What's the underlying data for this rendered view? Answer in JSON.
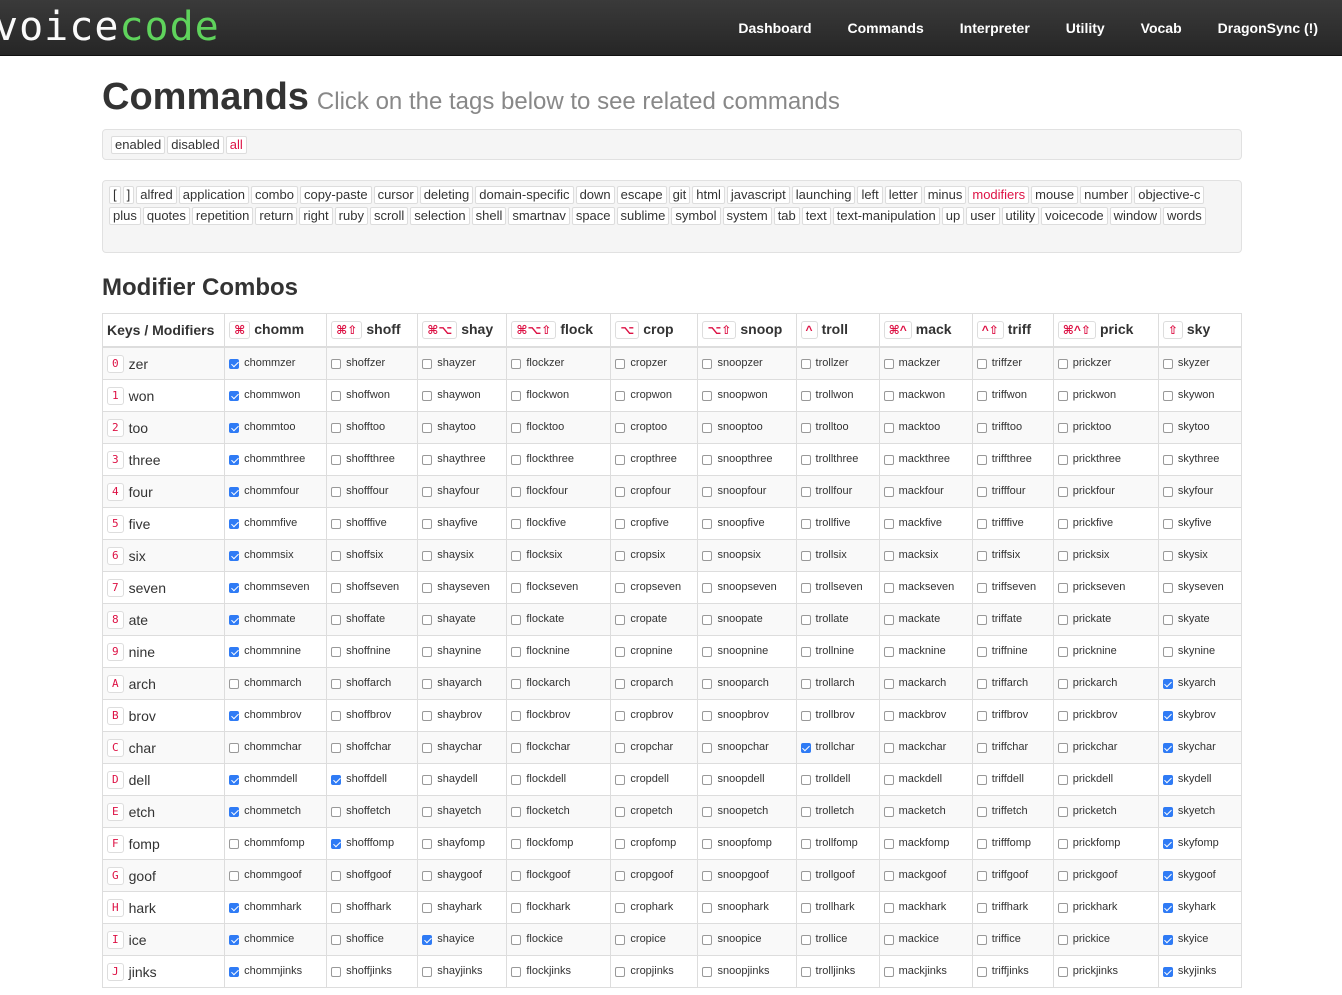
{
  "brand": {
    "part1": "voice",
    "part2": "code"
  },
  "nav": [
    "Dashboard",
    "Commands",
    "Interpreter",
    "Utility",
    "Vocab",
    "DragonSync (!)"
  ],
  "page": {
    "title": "Commands",
    "subtitle": "Click on the tags below to see related commands"
  },
  "status_filters": [
    {
      "label": "enabled",
      "active": false
    },
    {
      "label": "disabled",
      "active": false
    },
    {
      "label": "all",
      "active": true
    }
  ],
  "tags": [
    "[",
    "]",
    "alfred",
    "application",
    "combo",
    "copy-paste",
    "cursor",
    "deleting",
    "domain-specific",
    "down",
    "escape",
    "git",
    "html",
    "javascript",
    "launching",
    "left",
    "letter",
    "minus",
    "modifiers",
    "mouse",
    "number",
    "objective-c",
    "plus",
    "quotes",
    "repetition",
    "return",
    "right",
    "ruby",
    "scroll",
    "selection",
    "shell",
    "smartnav",
    "space",
    "sublime",
    "symbol",
    "system",
    "tab",
    "text",
    "text-manipulation",
    "up",
    "user",
    "utility",
    "voicecode",
    "window",
    "words"
  ],
  "active_tag": "modifiers",
  "section_title": "Modifier Combos",
  "table": {
    "first_header": "Keys / Modifiers",
    "modifiers": [
      {
        "symbol": "⌘",
        "name": "chomm"
      },
      {
        "symbol": "⌘⇧",
        "name": "shoff"
      },
      {
        "symbol": "⌘⌥",
        "name": "shay"
      },
      {
        "symbol": "⌘⌥⇧",
        "name": "flock"
      },
      {
        "symbol": "⌥",
        "name": "crop"
      },
      {
        "symbol": "⌥⇧",
        "name": "snoop"
      },
      {
        "symbol": "^",
        "name": "troll"
      },
      {
        "symbol": "⌘^",
        "name": "mack"
      },
      {
        "symbol": "^⇧",
        "name": "triff"
      },
      {
        "symbol": "⌘^⇧",
        "name": "prick"
      },
      {
        "symbol": "⇧",
        "name": "sky"
      }
    ],
    "rows": [
      {
        "key": "0",
        "spoken": "zer",
        "enabled": [
          1,
          0,
          0,
          0,
          0,
          0,
          0,
          0,
          0,
          0,
          0
        ]
      },
      {
        "key": "1",
        "spoken": "won",
        "enabled": [
          1,
          0,
          0,
          0,
          0,
          0,
          0,
          0,
          0,
          0,
          0
        ]
      },
      {
        "key": "2",
        "spoken": "too",
        "enabled": [
          1,
          0,
          0,
          0,
          0,
          0,
          0,
          0,
          0,
          0,
          0
        ]
      },
      {
        "key": "3",
        "spoken": "three",
        "enabled": [
          1,
          0,
          0,
          0,
          0,
          0,
          0,
          0,
          0,
          0,
          0
        ]
      },
      {
        "key": "4",
        "spoken": "four",
        "enabled": [
          1,
          0,
          0,
          0,
          0,
          0,
          0,
          0,
          0,
          0,
          0
        ]
      },
      {
        "key": "5",
        "spoken": "five",
        "enabled": [
          1,
          0,
          0,
          0,
          0,
          0,
          0,
          0,
          0,
          0,
          0
        ]
      },
      {
        "key": "6",
        "spoken": "six",
        "enabled": [
          1,
          0,
          0,
          0,
          0,
          0,
          0,
          0,
          0,
          0,
          0
        ]
      },
      {
        "key": "7",
        "spoken": "seven",
        "enabled": [
          1,
          0,
          0,
          0,
          0,
          0,
          0,
          0,
          0,
          0,
          0
        ]
      },
      {
        "key": "8",
        "spoken": "ate",
        "enabled": [
          1,
          0,
          0,
          0,
          0,
          0,
          0,
          0,
          0,
          0,
          0
        ]
      },
      {
        "key": "9",
        "spoken": "nine",
        "enabled": [
          1,
          0,
          0,
          0,
          0,
          0,
          0,
          0,
          0,
          0,
          0
        ]
      },
      {
        "key": "A",
        "spoken": "arch",
        "enabled": [
          0,
          0,
          0,
          0,
          0,
          0,
          0,
          0,
          0,
          0,
          1
        ]
      },
      {
        "key": "B",
        "spoken": "brov",
        "enabled": [
          1,
          0,
          0,
          0,
          0,
          0,
          0,
          0,
          0,
          0,
          1
        ]
      },
      {
        "key": "C",
        "spoken": "char",
        "enabled": [
          0,
          0,
          0,
          0,
          0,
          0,
          1,
          0,
          0,
          0,
          1
        ]
      },
      {
        "key": "D",
        "spoken": "dell",
        "enabled": [
          1,
          1,
          0,
          0,
          0,
          0,
          0,
          0,
          0,
          0,
          1
        ]
      },
      {
        "key": "E",
        "spoken": "etch",
        "enabled": [
          1,
          0,
          0,
          0,
          0,
          0,
          0,
          0,
          0,
          0,
          1
        ]
      },
      {
        "key": "F",
        "spoken": "fomp",
        "enabled": [
          0,
          1,
          0,
          0,
          0,
          0,
          0,
          0,
          0,
          0,
          1
        ]
      },
      {
        "key": "G",
        "spoken": "goof",
        "enabled": [
          0,
          0,
          0,
          0,
          0,
          0,
          0,
          0,
          0,
          0,
          1
        ]
      },
      {
        "key": "H",
        "spoken": "hark",
        "enabled": [
          1,
          0,
          0,
          0,
          0,
          0,
          0,
          0,
          0,
          0,
          1
        ]
      },
      {
        "key": "I",
        "spoken": "ice",
        "enabled": [
          1,
          0,
          1,
          0,
          0,
          0,
          0,
          0,
          0,
          0,
          1
        ]
      },
      {
        "key": "J",
        "spoken": "jinks",
        "enabled": [
          1,
          0,
          0,
          0,
          0,
          0,
          0,
          0,
          0,
          0,
          1
        ]
      }
    ]
  }
}
